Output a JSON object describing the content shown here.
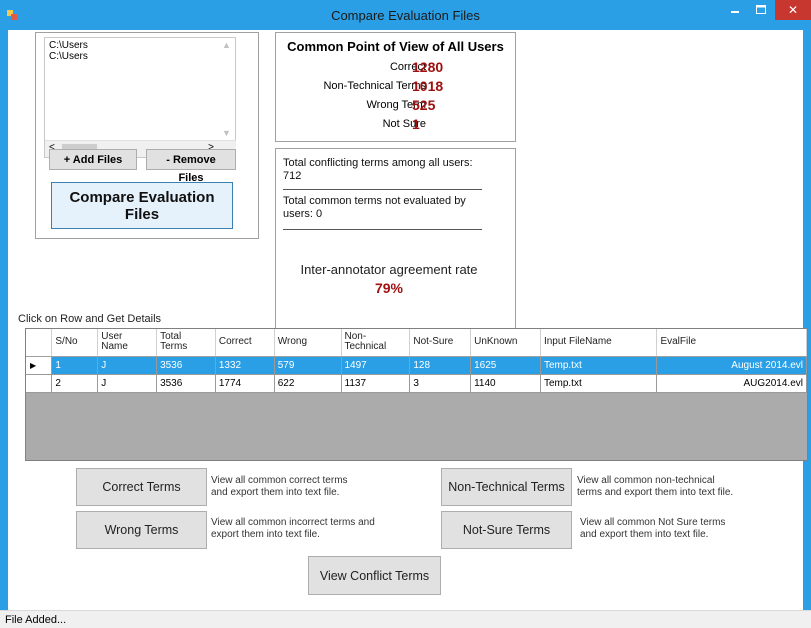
{
  "window": {
    "title": "Compare Evaluation Files",
    "close_glyph": "✕"
  },
  "files": {
    "items": [
      "C:\\Users",
      "C:\\Users"
    ],
    "add_label": "+ Add Files",
    "remove_label": "- Remove Files",
    "compare_label": "Compare Evaluation Files"
  },
  "pov": {
    "title": "Common Point of View of All Users",
    "stats": [
      {
        "label": "Correct",
        "value": "1280"
      },
      {
        "label": "Non-Technical Terms",
        "value": "1018"
      },
      {
        "label": "Wrong Term",
        "value": "525"
      },
      {
        "label": "Not Sure",
        "value": "1"
      }
    ]
  },
  "summary": {
    "conflicting": "Total conflicting terms among all users:\n712",
    "not_evaluated": "Total common terms not evaluated by\nusers: 0",
    "iaa_label": "Inter-annotator agreement rate",
    "iaa_value": "79%"
  },
  "grid": {
    "caption": "Click on Row and Get Details",
    "headers": [
      "S/No",
      "User\nName",
      "Total\nTerms",
      "Correct",
      "Wrong",
      "Non-Technical",
      "Not-Sure",
      "UnKnown",
      "Input FileName",
      "EvalFile"
    ],
    "rows": [
      [
        "1",
        "J",
        "3536",
        "1332",
        "579",
        "1497",
        "128",
        "1625",
        "Temp.txt",
        "August 2014.evl"
      ],
      [
        "2",
        "J",
        "3536",
        "1774",
        "622",
        "1137",
        "3",
        "1140",
        "Temp.txt",
        "AUG2014.evl"
      ]
    ],
    "selected_marker": "▶"
  },
  "actions": {
    "correct_label": "Correct Terms",
    "correct_desc": "View all common correct terms\nand export them into text file.",
    "wrong_label": "Wrong Terms",
    "wrong_desc": "View all common incorrect terms and\nexport them into text file.",
    "nontech_label": "Non-Technical Terms",
    "nontech_desc": "View all common non-technical\nterms and export them into text file.",
    "notsure_label": "Not-Sure Terms",
    "notsure_desc": "View all common Not Sure  terms\nand export them into text file.",
    "conflict_label": "View Conflict Terms"
  },
  "status": {
    "text": "File Added..."
  },
  "colors": {
    "accent": "#2b9fe6",
    "value_red": "#a01010",
    "close_red": "#c7372f"
  }
}
